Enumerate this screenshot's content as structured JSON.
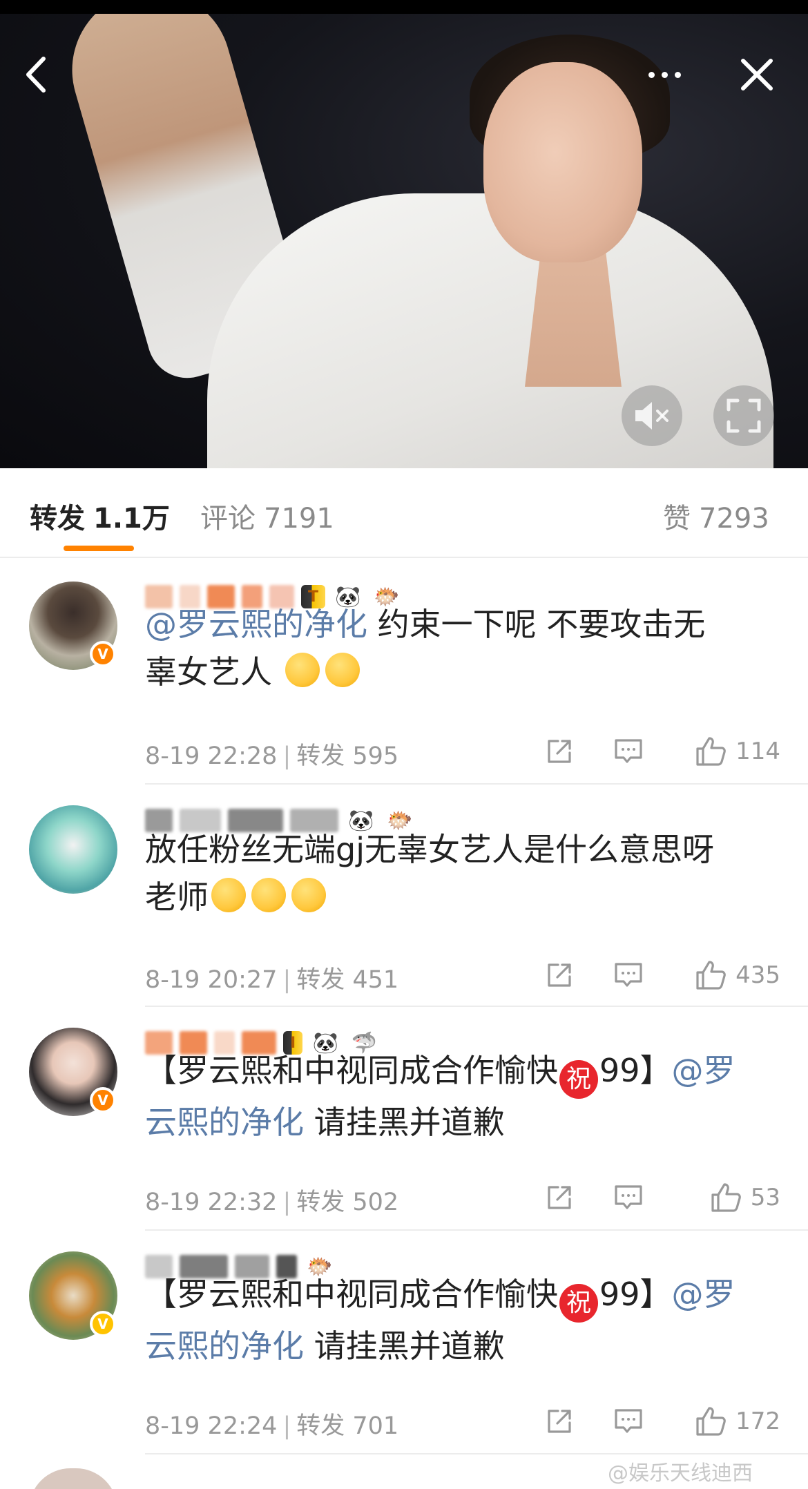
{
  "video": {
    "muted": true
  },
  "tabs": {
    "repost_label": "转发",
    "repost_count": "1.1万",
    "comments_label": "评论",
    "comments_count": "7191",
    "likes_label": "赞",
    "likes_count": "7293",
    "active": "repost",
    "accent_color": "#ff8200"
  },
  "reposts": [
    {
      "verified_color": "#ff8200",
      "mention": "@罗云熙的净化",
      "text_line1_rest": " 约束一下呢  不要攻击无",
      "text_line2": "辜女艺人",
      "emoji_count": 2,
      "date": "8-19 22:28",
      "repost_label": "转发",
      "repost_count": "595",
      "likes": "114"
    },
    {
      "text_line1": "放任粉丝无端gj无辜女艺人是什么意思呀",
      "text_line2": "老师",
      "emoji_count": 3,
      "date": "8-19 20:27",
      "repost_label": "转发",
      "repost_count": "451",
      "likes": "435"
    },
    {
      "verified_color": "#ff8200",
      "text_prefix": "【罗云熙和中视同成合作愉快",
      "zhu": "祝",
      "text_suffix": "99】",
      "mention_part1": "@罗",
      "mention_part2": "云熙的净化",
      "text_rest": " 请挂黑并道歉",
      "date": "8-19 22:32",
      "repost_label": "转发",
      "repost_count": "502",
      "likes": "53"
    },
    {
      "verified_color": "#ffc300",
      "text_prefix": "【罗云熙和中视同成合作愉快",
      "zhu": "祝",
      "text_suffix": "99】",
      "mention_part1": "@罗",
      "mention_part2": "云熙的净化",
      "text_rest": " 请挂黑并道歉",
      "date": "8-19 22:24",
      "repost_label": "转发",
      "repost_count": "701",
      "likes": "172"
    }
  ],
  "watermark": "@娱乐天线迪西",
  "icons": {
    "back": "chevron-left-icon",
    "more": "more-dots-icon",
    "close": "close-icon",
    "mute": "speaker-muted-icon",
    "fullscreen": "fullscreen-icon",
    "share": "share-icon",
    "comment": "comment-icon",
    "like": "thumbs-up-icon"
  }
}
